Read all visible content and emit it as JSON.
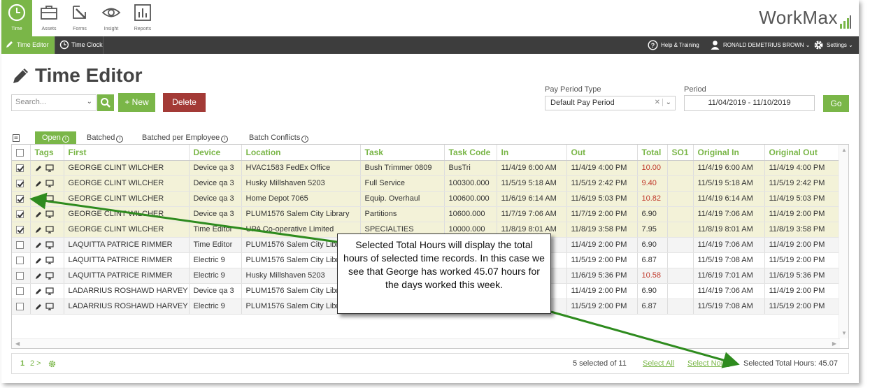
{
  "nav": {
    "items": [
      {
        "label": "Time",
        "icon": "clock-icon",
        "active": true
      },
      {
        "label": "Assets",
        "icon": "briefcase-icon",
        "active": false
      },
      {
        "label": "Forms",
        "icon": "forms-icon",
        "active": false
      },
      {
        "label": "Insight",
        "icon": "eye-icon",
        "active": false
      },
      {
        "label": "Reports",
        "icon": "reports-icon",
        "active": false
      }
    ],
    "logo": "WorkMax"
  },
  "subnav": {
    "tabs": [
      {
        "label": "Time Editor",
        "active": true
      },
      {
        "label": "Time Clock",
        "active": false
      }
    ],
    "help": "Help & Training",
    "user": "RONALD DEMETRIUS BROWN",
    "settings": "Settings"
  },
  "page": {
    "title": "Time Editor"
  },
  "toolbar": {
    "search_placeholder": "Search...",
    "new_label": "+ New",
    "delete_label": "Delete",
    "pay_period_type_label": "Pay Period Type",
    "pay_period_type_value": "Default Pay Period",
    "period_label": "Period",
    "period_value": "11/04/2019 - 11/10/2019",
    "go_label": "Go"
  },
  "view_tabs": [
    {
      "label": "Open",
      "active": true
    },
    {
      "label": "Batched",
      "active": false
    },
    {
      "label": "Batched per Employee",
      "active": false
    },
    {
      "label": "Batch Conflicts",
      "active": false
    }
  ],
  "table": {
    "columns": [
      "Tags",
      "First",
      "Device",
      "Location",
      "Task",
      "Task Code",
      "In",
      "Out",
      "Total",
      "SO1",
      "Original In",
      "Original Out"
    ],
    "rows": [
      {
        "selected": true,
        "first": "GEORGE CLINT WILCHER",
        "device": "Device qa 3",
        "location": "HVAC1583 FedEx Office",
        "task": "Bush Trimmer 0809",
        "task_code": "BusTri",
        "in": "11/4/19 6:00 AM",
        "out": "11/4/19 4:00 PM",
        "total": "10.00",
        "total_over": true,
        "so1": "",
        "orig_in": "11/4/19 6:00 AM",
        "orig_out": "11/4/19 4:00 PM"
      },
      {
        "selected": true,
        "first": "GEORGE CLINT WILCHER",
        "device": "Device qa 3",
        "location": "Husky Millshaven 5203",
        "task": "Full Service",
        "task_code": "100300.000",
        "in": "11/5/19 5:18 AM",
        "out": "11/5/19 2:42 PM",
        "total": "9.40",
        "total_over": true,
        "so1": "",
        "orig_in": "11/5/19 5:18 AM",
        "orig_out": "11/5/19 2:42 PM"
      },
      {
        "selected": true,
        "first": "GEORGE CLINT WILCHER",
        "device": "Device qa 3",
        "location": "Home Depot 7065",
        "task": "Equip. Overhaul",
        "task_code": "100600.000",
        "in": "11/6/19 6:14 AM",
        "out": "11/6/19 5:03 PM",
        "total": "10.82",
        "total_over": true,
        "so1": "",
        "orig_in": "11/4/19 6:14 AM",
        "orig_out": "11/4/19 5:03 PM"
      },
      {
        "selected": true,
        "first": "GEORGE CLINT WILCHER",
        "device": "Device qa 3",
        "location": "PLUM1576 Salem City Library",
        "task": "Partitions",
        "task_code": "10600.000",
        "in": "11/7/19 7:06 AM",
        "out": "11/7/19 2:00 PM",
        "total": "6.90",
        "total_over": false,
        "so1": "",
        "orig_in": "11/4/19 7:06 AM",
        "orig_out": "11/4/19 2:00 PM"
      },
      {
        "selected": true,
        "first": "GEORGE CLINT WILCHER",
        "device": "Time Editor",
        "location": "UPA Co-operative Limited",
        "task": "SPECIALTIES",
        "task_code": "10000.000",
        "in": "11/8/19 8:01 AM",
        "out": "11/8/19 3:58 PM",
        "total": "7.95",
        "total_over": false,
        "so1": "",
        "orig_in": "11/8/19 8:01 AM",
        "orig_out": "11/8/19 3:58 PM"
      },
      {
        "selected": false,
        "first": "LAQUITTA PATRICE RIMMER",
        "device": "Time Editor",
        "location": "PLUM1576 Salem City Library",
        "task": "",
        "task_code": "",
        "in": "",
        "out": "11/4/19 2:00 PM",
        "total": "6.90",
        "total_over": false,
        "so1": "",
        "orig_in": "11/4/19 7:06 AM",
        "orig_out": "11/4/19 2:00 PM"
      },
      {
        "selected": false,
        "first": "LAQUITTA PATRICE RIMMER",
        "device": "Electric 9",
        "location": "PLUM1576 Salem City Library",
        "task": "",
        "task_code": "",
        "in": "",
        "out": "11/5/19 2:00 PM",
        "total": "6.87",
        "total_over": false,
        "so1": "",
        "orig_in": "11/5/19 7:08 AM",
        "orig_out": "11/5/19 2:00 PM"
      },
      {
        "selected": false,
        "first": "LAQUITTA PATRICE RIMMER",
        "device": "Electric 9",
        "location": "Husky Millshaven 5203",
        "task": "",
        "task_code": "",
        "in": "",
        "out": "11/6/19 5:36 PM",
        "total": "10.58",
        "total_over": true,
        "so1": "",
        "orig_in": "11/6/19 7:01 AM",
        "orig_out": "11/6/19 5:36 PM"
      },
      {
        "selected": false,
        "first": "LADARRIUS ROSHAWD HARVEY",
        "device": "Device qa 3",
        "location": "PLUM1576 Salem City Library",
        "task": "",
        "task_code": "",
        "in": "",
        "out": "11/4/19 2:00 PM",
        "total": "6.90",
        "total_over": false,
        "so1": "",
        "orig_in": "11/4/19 7:06 AM",
        "orig_out": "11/4/19 2:00 PM"
      },
      {
        "selected": false,
        "first": "LADARRIUS ROSHAWD HARVEY",
        "device": "Electric 9",
        "location": "PLUM1576 Salem City Library",
        "task": "",
        "task_code": "",
        "in": "",
        "out": "11/5/19 2:00 PM",
        "total": "6.87",
        "total_over": false,
        "so1": "",
        "orig_in": "11/5/19 7:08 AM",
        "orig_out": "11/5/19 2:00 PM"
      }
    ]
  },
  "footer": {
    "page_current": "1",
    "page_next": "2 >",
    "selected_count": "5 selected of 11",
    "select_all": "Select All",
    "select_none": "Select None",
    "selected_total": "Selected Total Hours: 45.07"
  },
  "callout": {
    "text": "Selected Total Hours will display the total hours of selected time records.  In this case we see that George has worked 45.07 hours for the days worked this week."
  },
  "colors": {
    "accent": "#7ab648",
    "danger": "#a33a36",
    "dark_bar": "#3d3d3d",
    "selected_row": "#f3f2d8",
    "over_hours": "#c0392b",
    "arrow": "#2e8b1e"
  }
}
